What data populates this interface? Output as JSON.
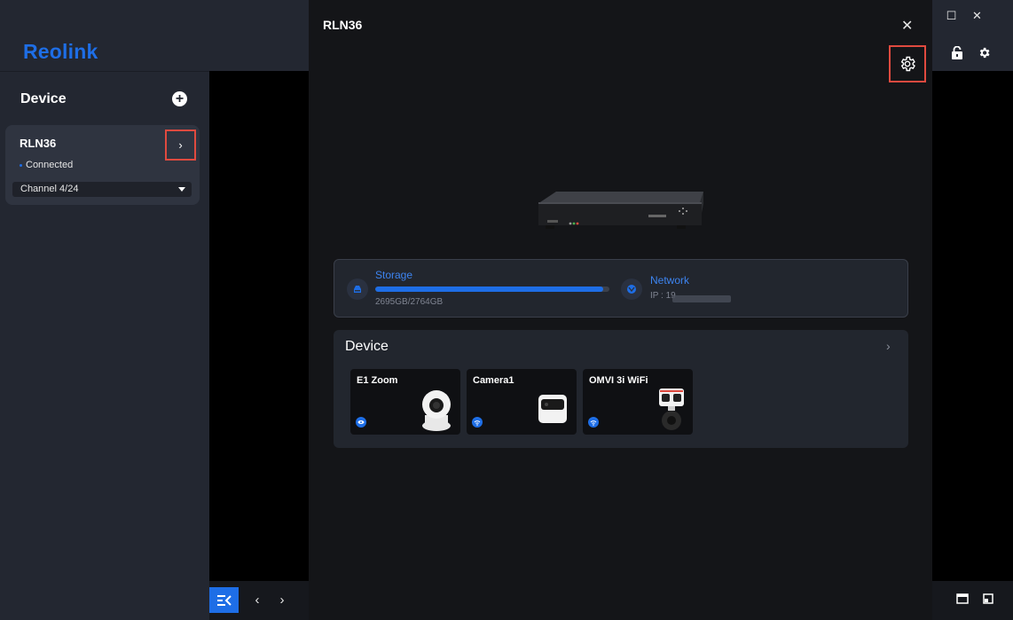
{
  "app": {
    "logo": "Reolink"
  },
  "window_controls": {
    "minimize": "–",
    "maximize": "☐",
    "close": "✕"
  },
  "sidebar": {
    "title": "Device",
    "add_label": "+",
    "device": {
      "name": "RLN36",
      "status": "Connected",
      "channel": "Channel 4/24",
      "arrow": "›"
    }
  },
  "drawer": {
    "title": "RLN36",
    "close": "✕",
    "storage": {
      "label": "Storage",
      "used_text": "2695GB/2764GB",
      "used_fraction": 0.975
    },
    "network": {
      "label": "Network",
      "ip_prefix": "IP : 19"
    },
    "devices_section": {
      "title": "Device",
      "arrow": "›",
      "cameras": [
        {
          "name": "E1 Zoom",
          "icon": "ethernet-icon"
        },
        {
          "name": "Camera1",
          "icon": "wifi-icon"
        },
        {
          "name": "OMVI 3i WiFi",
          "icon": "wifi-icon"
        }
      ]
    }
  },
  "bottombar": {
    "prev": "‹",
    "next": "›"
  },
  "colors": {
    "accent": "#1e6ee6",
    "highlight": "#e04a3f",
    "panel": "#232731",
    "drawer": "#141518"
  }
}
